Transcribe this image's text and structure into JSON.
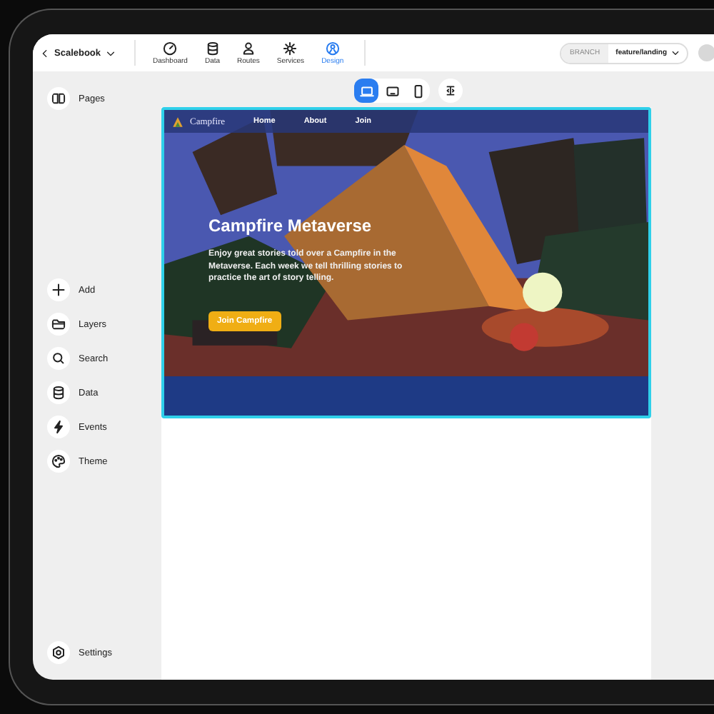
{
  "topbar": {
    "project": "Scalebook",
    "nav": [
      {
        "label": "Dashboard",
        "selected": false
      },
      {
        "label": "Data",
        "selected": false
      },
      {
        "label": "Routes",
        "selected": false
      },
      {
        "label": "Services",
        "selected": false
      },
      {
        "label": "Design",
        "selected": true
      }
    ],
    "branch": {
      "label": "BRANCH",
      "value": "feature/landing"
    }
  },
  "sidebar": {
    "top": [
      "Pages"
    ],
    "tools": [
      "Add",
      "Layers",
      "Search",
      "Data",
      "Events",
      "Theme"
    ],
    "bottom": [
      "Settings"
    ]
  },
  "devices": [
    {
      "kind": "desktop",
      "selected": true
    },
    {
      "kind": "tablet",
      "selected": false
    },
    {
      "kind": "phone",
      "selected": false
    }
  ],
  "preview": {
    "brand": "Campfire",
    "links": [
      "Home",
      "About",
      "Join"
    ],
    "title": "Campfire Metaverse",
    "text": "Enjoy great stories told over a Campfire in the Metaverse. Each week we tell thrilling stories to practice the art of story telling.",
    "button": "Join Campfire"
  }
}
